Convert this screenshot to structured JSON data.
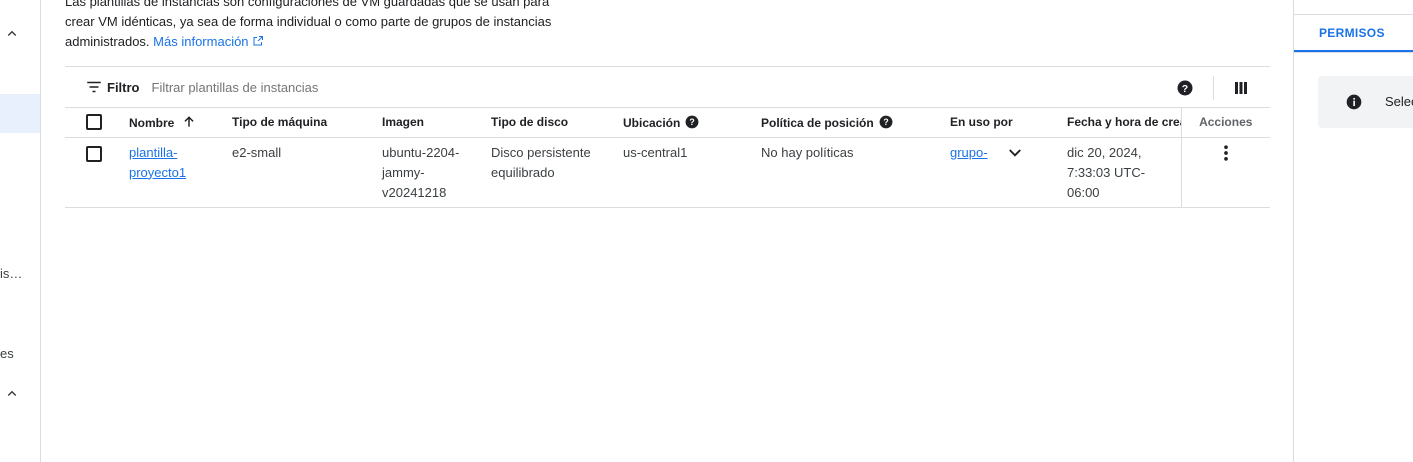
{
  "sidebar": {
    "truncated_items": [
      "is…",
      "es"
    ]
  },
  "description": {
    "line1": "Las plantillas de instancias son configuraciones de VM guardadas que se usan para",
    "line2": "crear VM idénticas, ya sea de forma individual o como parte de grupos de instancias",
    "line3": "administrados.",
    "link": "Más información"
  },
  "toolbar": {
    "filter_label": "Filtro",
    "filter_placeholder": "Filtrar plantillas de instancias"
  },
  "table": {
    "columns": [
      "Nombre",
      "Tipo de máquina",
      "Imagen",
      "Tipo de disco",
      "Ubicación",
      "Política de posición",
      "En uso por",
      "Fecha y hora de creaci",
      "Acciones"
    ],
    "rows": [
      {
        "name": "plantilla-proyecto1",
        "machine_type": "e2-small",
        "image": "ubuntu-2204-jammy-v20241218",
        "disk_type": "Disco persistente equilibrado",
        "location": "us-central1",
        "placement_policy": "No hay políticas",
        "in_use_by": "grupo-",
        "created": "dic 20, 2024, 7:33:03 UTC-06:00"
      }
    ]
  },
  "right_panel": {
    "tab": "PERMISOS",
    "info_text": "Selec"
  },
  "colors": {
    "accent": "#1a73e8",
    "border": "#dadce0"
  }
}
